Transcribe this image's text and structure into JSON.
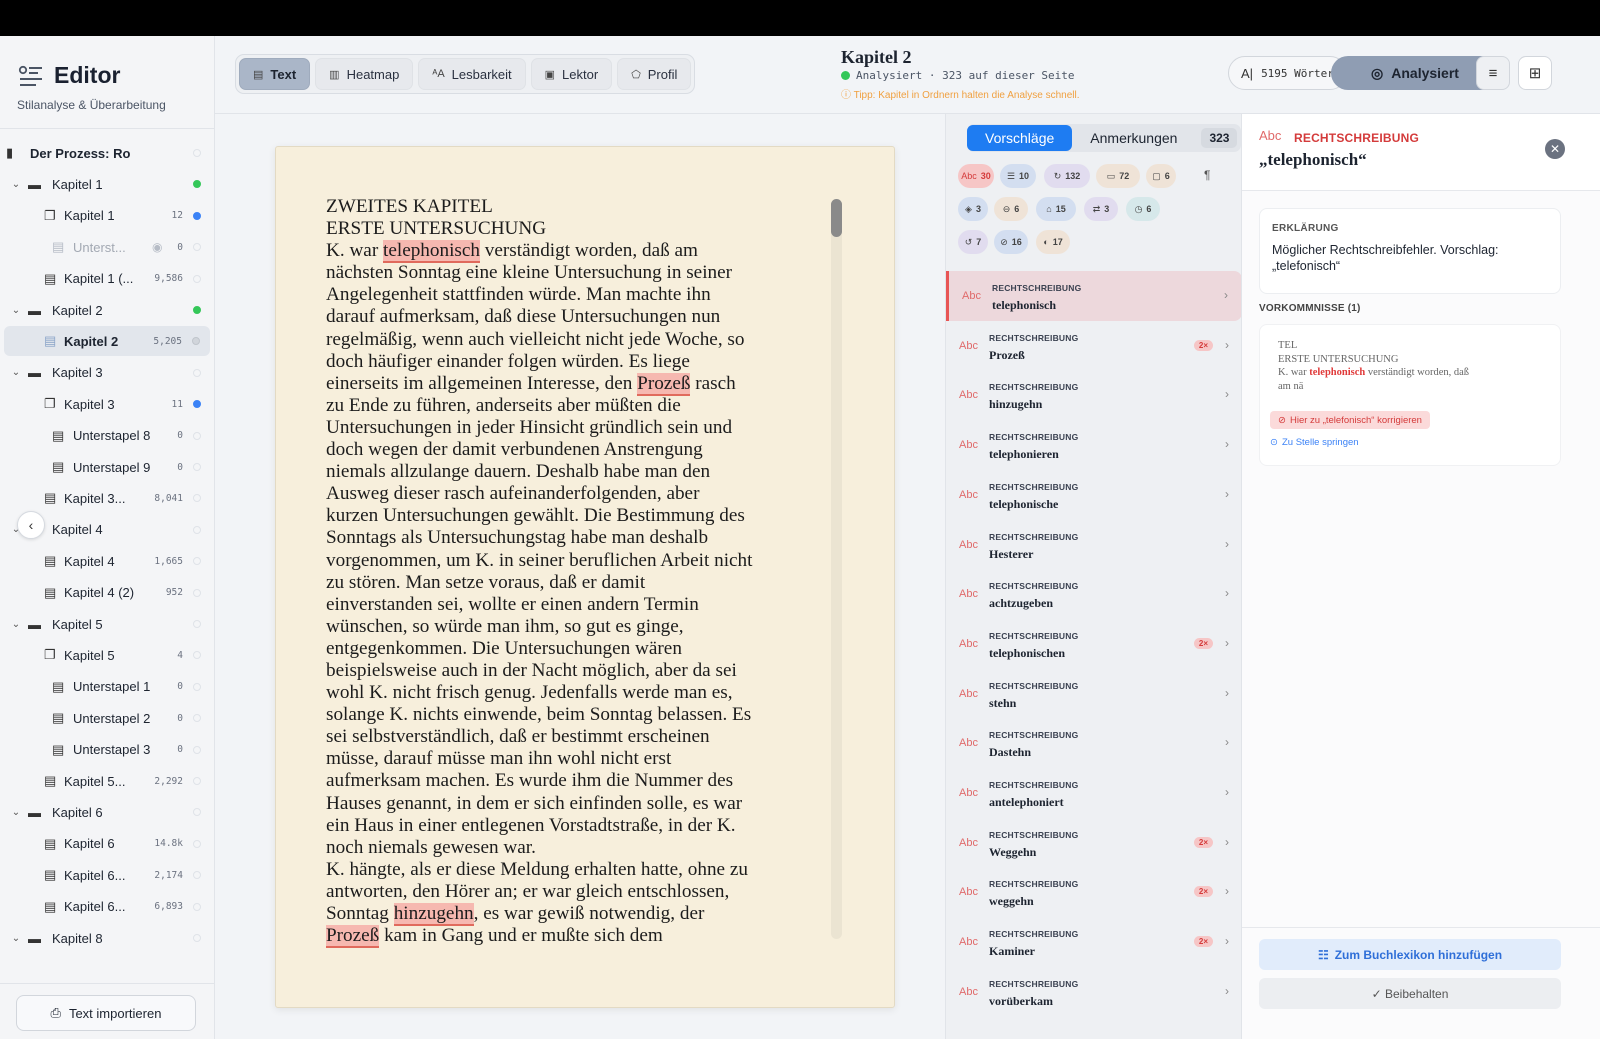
{
  "sidebar": {
    "title": "Editor",
    "subtitle": "Stilanalyse & Überarbeitung",
    "tree": [
      {
        "label": "Der Prozess: Roma...",
        "count": "",
        "status": "empty",
        "icon": "book-icon",
        "chev": "",
        "indent": 0
      },
      {
        "label": "Kapitel 1",
        "count": "",
        "status": "green",
        "icon": "folder-icon",
        "chev": "⌄",
        "indent": 0
      },
      {
        "label": "Kapitel 1",
        "count": "12",
        "status": "blue",
        "icon": "stack-icon",
        "chev": "",
        "indent": 1
      },
      {
        "label": "Unterst...",
        "count": "0",
        "status": "empty",
        "icon": "doc-icon",
        "chev": "",
        "indent": 2,
        "muted": true
      },
      {
        "label": "Kapitel 1 (...",
        "count": "9,586",
        "status": "empty",
        "icon": "doc-icon",
        "chev": "",
        "indent": 1
      },
      {
        "label": "Kapitel 2",
        "count": "",
        "status": "green",
        "icon": "folder-icon",
        "chev": "⌄",
        "indent": 0
      },
      {
        "label": "Kapitel 2",
        "count": "5,205",
        "status": "gray",
        "icon": "doc-icon",
        "chev": "",
        "indent": 1,
        "selected": true
      },
      {
        "label": "Kapitel 3",
        "count": "",
        "status": "empty",
        "icon": "folder-icon",
        "chev": "⌄",
        "indent": 0
      },
      {
        "label": "Kapitel 3",
        "count": "11",
        "status": "blue",
        "icon": "stack-icon",
        "chev": "",
        "indent": 1
      },
      {
        "label": "Unterstapel 8",
        "count": "0",
        "status": "empty",
        "icon": "doc-icon",
        "chev": "",
        "indent": 2
      },
      {
        "label": "Unterstapel 9",
        "count": "0",
        "status": "empty",
        "icon": "doc-icon",
        "chev": "",
        "indent": 2
      },
      {
        "label": "Kapitel 3...",
        "count": "8,041",
        "status": "empty",
        "icon": "doc-icon",
        "chev": "",
        "indent": 1
      },
      {
        "label": "Kapitel 4",
        "count": "",
        "status": "empty",
        "icon": "folder-icon",
        "chev": "⌄",
        "indent": 0
      },
      {
        "label": "Kapitel 4",
        "count": "1,665",
        "status": "empty",
        "icon": "doc-icon",
        "chev": "",
        "indent": 1
      },
      {
        "label": "Kapitel 4 (2)",
        "count": "952",
        "status": "empty",
        "icon": "doc-icon",
        "chev": "",
        "indent": 1
      },
      {
        "label": "Kapitel 5",
        "count": "",
        "status": "empty",
        "icon": "folder-icon",
        "chev": "⌄",
        "indent": 0
      },
      {
        "label": "Kapitel 5",
        "count": "4",
        "status": "empty",
        "icon": "stack-icon",
        "chev": "",
        "indent": 1
      },
      {
        "label": "Unterstapel 1",
        "count": "0",
        "status": "empty",
        "icon": "doc-icon",
        "chev": "",
        "indent": 2
      },
      {
        "label": "Unterstapel 2",
        "count": "0",
        "status": "empty",
        "icon": "doc-icon",
        "chev": "",
        "indent": 2
      },
      {
        "label": "Unterstapel 3",
        "count": "0",
        "status": "empty",
        "icon": "doc-icon",
        "chev": "",
        "indent": 2
      },
      {
        "label": "Kapitel 5...",
        "count": "2,292",
        "status": "empty",
        "icon": "doc-icon",
        "chev": "",
        "indent": 1
      },
      {
        "label": "Kapitel 6",
        "count": "",
        "status": "empty",
        "icon": "folder-icon",
        "chev": "⌄",
        "indent": 0
      },
      {
        "label": "Kapitel 6",
        "count": "14.8k",
        "status": "empty",
        "icon": "doc-icon",
        "chev": "",
        "indent": 1
      },
      {
        "label": "Kapitel 6...",
        "count": "2,174",
        "status": "empty",
        "icon": "doc-icon",
        "chev": "",
        "indent": 1
      },
      {
        "label": "Kapitel 6...",
        "count": "6,893",
        "status": "empty",
        "icon": "doc-icon",
        "chev": "",
        "indent": 1
      },
      {
        "label": "Kapitel 8",
        "count": "",
        "status": "empty",
        "icon": "folder-icon",
        "chev": "⌄",
        "indent": 0
      }
    ],
    "import_label": "Text importieren"
  },
  "toolbar": {
    "tabs": [
      {
        "label": "Text",
        "icon": "document-icon",
        "active": true
      },
      {
        "label": "Heatmap",
        "icon": "heatmap-icon",
        "active": false
      },
      {
        "label": "Lesbarkeit",
        "icon": "font-size-icon",
        "active": false
      },
      {
        "label": "Lektor",
        "icon": "lector-icon",
        "active": false
      },
      {
        "label": "Profil",
        "icon": "profile-icon",
        "active": false
      }
    ],
    "doc_title": "Kapitel 2",
    "doc_status": "Analysiert · 323 auf dieser Seite",
    "tip": "ⓘ Tipp: Kapitel in Ordnern halten die Analyse schnell.",
    "words": "5195 Wörter",
    "analysiert_label": "Analysiert"
  },
  "editor": {
    "segments": [
      {
        "t": "ZWEITES KAPITEL\nERSTE UNTERSUCHUNG\nK. war "
      },
      {
        "t": "telephonisch",
        "hl": true
      },
      {
        "t": " verständigt worden, daß am\nnächsten Sonntag eine kleine Untersuchung in seiner\nAngelegenheit stattfinden würde. Man machte ihn\ndarauf aufmerksam, daß diese Untersuchungen nun\nregelmäßig, wenn auch vielleicht nicht jede Woche, so\ndoch häufiger einander folgen würden. Es liege\neinerseits im allgemeinen Interesse, den "
      },
      {
        "t": "Prozeß",
        "hl": true
      },
      {
        "t": " rasch\nzu Ende zu führen, anderseits aber müßten die\nUntersuchungen in jeder Hinsicht gründlich sein und\ndoch wegen der damit verbundenen Anstrengung\nniemals allzulange dauern. Deshalb habe man den\nAusweg dieser rasch aufeinanderfolgenden, aber\nkurzen Untersuchungen gewählt. Die Bestimmung des\nSonntags als Untersuchungstag habe man deshalb\nvorgenommen, um K. in seiner beruflichen Arbeit nicht\nzu stören. Man setze voraus, daß er damit\neinverstanden sei, wollte er einen andern Termin\nwünschen, so würde man ihm, so gut es ginge,\nentgegenkommen. Die Untersuchungen wären\nbeispielsweise auch in der Nacht möglich, aber da sei\nwohl K. nicht frisch genug. Jedenfalls werde man es,\nsolange K. nichts einwende, beim Sonntag belassen. Es\nsei selbstverständlich, daß er bestimmt erscheinen\nmüsse, darauf müsse man ihn wohl nicht erst\naufmerksam machen. Es wurde ihm die Nummer des\nHauses genannt, in dem er sich einfinden solle, es war\nein Haus in einer entlegenen Vorstadtstraße, in der K.\nnoch niemals gewesen war.\nK. hängte, als er diese Meldung erhalten hatte, ohne zu\nantworten, den Hörer an; er war gleich entschlossen,\nSonntag "
      },
      {
        "t": "hinzugehn",
        "hl": true
      },
      {
        "t": ", es war gewiß notwendig, der\n"
      },
      {
        "t": "Prozeß",
        "hl": true
      },
      {
        "t": " kam in Gang und er mußte sich dem"
      }
    ],
    "scroll_position": 0.0
  },
  "suggestions": {
    "tab_suggestions": "Vorschläge",
    "tab_notes": "Anmerkungen",
    "total": "323",
    "chips": [
      {
        "icon": "Abc",
        "count": "30",
        "style": "red"
      },
      {
        "icon": "☰",
        "count": "10",
        "style": "blue"
      },
      {
        "icon": "↻",
        "count": "132",
        "style": "violet"
      },
      {
        "icon": "▭",
        "count": "72",
        "style": "peach"
      },
      {
        "icon": "▢",
        "count": "6",
        "style": "peach"
      },
      {
        "icon": "◈",
        "count": "3",
        "style": "blue"
      },
      {
        "icon": "⊖",
        "count": "6",
        "style": "peach"
      },
      {
        "icon": "⌂",
        "count": "15",
        "style": "blue"
      },
      {
        "icon": "⇄",
        "count": "3",
        "style": "violet"
      },
      {
        "icon": "◷",
        "count": "6",
        "style": "teal"
      },
      {
        "icon": "↺",
        "count": "7",
        "style": "violet"
      },
      {
        "icon": "⊘",
        "count": "16",
        "style": "blue"
      },
      {
        "icon": "◐",
        "count": "17",
        "style": "peach"
      }
    ],
    "pilcrow": "¶",
    "items": [
      {
        "category": "RECHTSCHREIBUNG",
        "word": "telephonisch",
        "badge": "",
        "active": true
      },
      {
        "category": "RECHTSCHREIBUNG",
        "word": "Prozeß",
        "badge": "2×"
      },
      {
        "category": "RECHTSCHREIBUNG",
        "word": "hinzugehn",
        "badge": ""
      },
      {
        "category": "RECHTSCHREIBUNG",
        "word": "telephonieren",
        "badge": ""
      },
      {
        "category": "RECHTSCHREIBUNG",
        "word": "telephonische",
        "badge": ""
      },
      {
        "category": "RECHTSCHREIBUNG",
        "word": "Hesterer",
        "badge": ""
      },
      {
        "category": "RECHTSCHREIBUNG",
        "word": "achtzugeben",
        "badge": ""
      },
      {
        "category": "RECHTSCHREIBUNG",
        "word": "telephonischen",
        "badge": "2×"
      },
      {
        "category": "RECHTSCHREIBUNG",
        "word": "stehn",
        "badge": ""
      },
      {
        "category": "RECHTSCHREIBUNG",
        "word": "Dastehn",
        "badge": ""
      },
      {
        "category": "RECHTSCHREIBUNG",
        "word": "antelephoniert",
        "badge": ""
      },
      {
        "category": "RECHTSCHREIBUNG",
        "word": "Weggehn",
        "badge": "2×"
      },
      {
        "category": "RECHTSCHREIBUNG",
        "word": "weggehn",
        "badge": "2×"
      },
      {
        "category": "RECHTSCHREIBUNG",
        "word": "Kaminer",
        "badge": "2×"
      },
      {
        "category": "RECHTSCHREIBUNG",
        "word": "vorüberkam",
        "badge": ""
      }
    ]
  },
  "detail": {
    "abc": "Abc",
    "category": "RECHTSCHREIBUNG",
    "word": "„telephonisch“",
    "explanation_heading": "ERKLÄRUNG",
    "explanation": "Möglicher Rechtschreibfehler. Vorschlag: „telefonisch“",
    "occurrences_heading": "VORKOMMNISSE (1)",
    "context_before": "TEL\nERSTE UNTERSUCHUNG\nK. war ",
    "context_word": "telephonisch",
    "context_after": " verständigt worden, daß\nam nä",
    "fix_label": "Hier zu „telefonisch“ korrigieren",
    "jump_label": "Zu Stelle springen",
    "lexicon_label": "Zum Buchlexikon hinzufügen",
    "keep_label": "✓ Beibehalten"
  },
  "colors": {
    "accent_blue": "#1e7cf2",
    "error_red": "#d43b3b",
    "paper": "#f7efdc",
    "status_green": "#34c759"
  }
}
